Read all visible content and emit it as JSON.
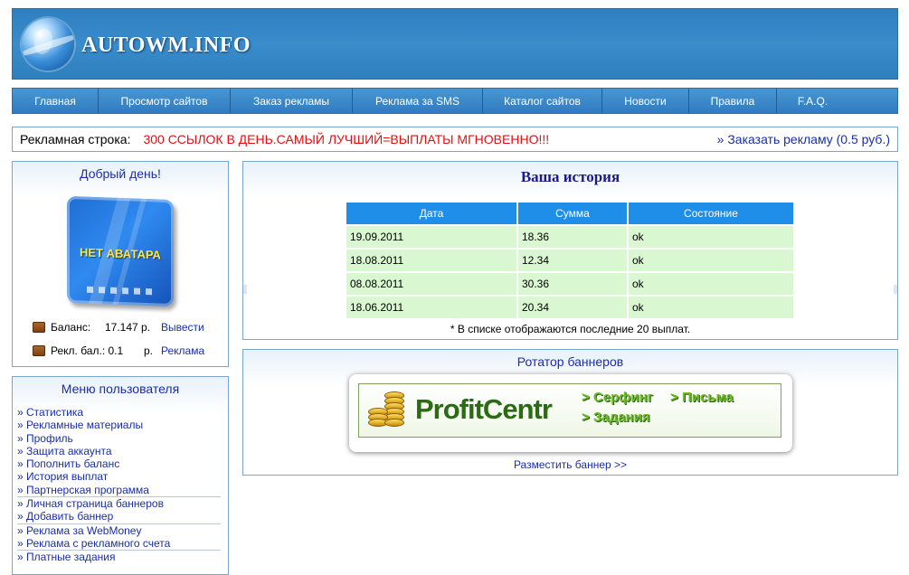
{
  "header": {
    "title": "AUTOWM.INFO"
  },
  "nav": {
    "items": [
      {
        "label": "Главная",
        "w": 95
      },
      {
        "label": "Просмотр сайтов",
        "w": 146
      },
      {
        "label": "Заказ рекламы",
        "w": 135
      },
      {
        "label": "Реклама за SMS",
        "w": 144
      },
      {
        "label": "Каталог сайтов",
        "w": 132
      },
      {
        "label": "Новости",
        "w": 96
      },
      {
        "label": "Правила",
        "w": 97
      },
      {
        "label": "F.A.Q.",
        "w": 79
      }
    ]
  },
  "adline": {
    "label": "Рекламная строка:",
    "text": "300 ССЫЛОК В ДЕНЬ.САМЫЙ ЛУЧШИЙ=ВЫПЛАТЫ МГНОВЕННО!!!",
    "order": "» Заказать рекламу (0.5 руб.)"
  },
  "user": {
    "greeting": "Добрый день!",
    "avatar_text": "НЕТ АВАТАРА",
    "balance_label": "Баланс:",
    "balance_value": "17.147 р.",
    "withdraw": "Вывести",
    "ad_balance_label": "Рекл. бал.: 0.1",
    "ad_balance_unit": "р.",
    "ad_link": "Реклама"
  },
  "menu": {
    "title": "Меню пользователя",
    "items": [
      "» Статистика",
      "» Рекламные материалы",
      "» Профиль",
      "» Защита аккаунта",
      "» Пополнить баланс",
      "» История выплат",
      "» Партнерская программа",
      "» Личная страница баннеров",
      "» Добавить баннер",
      "» Реклама за WebMoney",
      "» Реклама с рекламного счета",
      "» Платные задания"
    ]
  },
  "history": {
    "title": "Ваша история",
    "columns": [
      "Дата",
      "Сумма",
      "Состояние"
    ],
    "rows": [
      [
        "19.09.2011",
        "18.36",
        "ok"
      ],
      [
        "18.08.2011",
        "12.34",
        "ok"
      ],
      [
        "08.08.2011",
        "30.36",
        "ok"
      ],
      [
        "18.06.2011",
        "20.34",
        "ok"
      ]
    ],
    "note": "* В списке отображаются последние 20 выплат."
  },
  "banners": {
    "title": "Ротатор баннеров",
    "brand": "ProfitCentr",
    "link1": "> Серфинг",
    "link2": "> Письма",
    "link3": "> Задания",
    "place": "Разместить баннер >>"
  },
  "colors": {
    "header_bg": "#3a8ccb",
    "nav_bg": "#2f7dc0",
    "link": "#1a2ea8",
    "ad_text": "#e01010",
    "table_head": "#1e8ee8",
    "table_cell": "#d9f7d0"
  }
}
